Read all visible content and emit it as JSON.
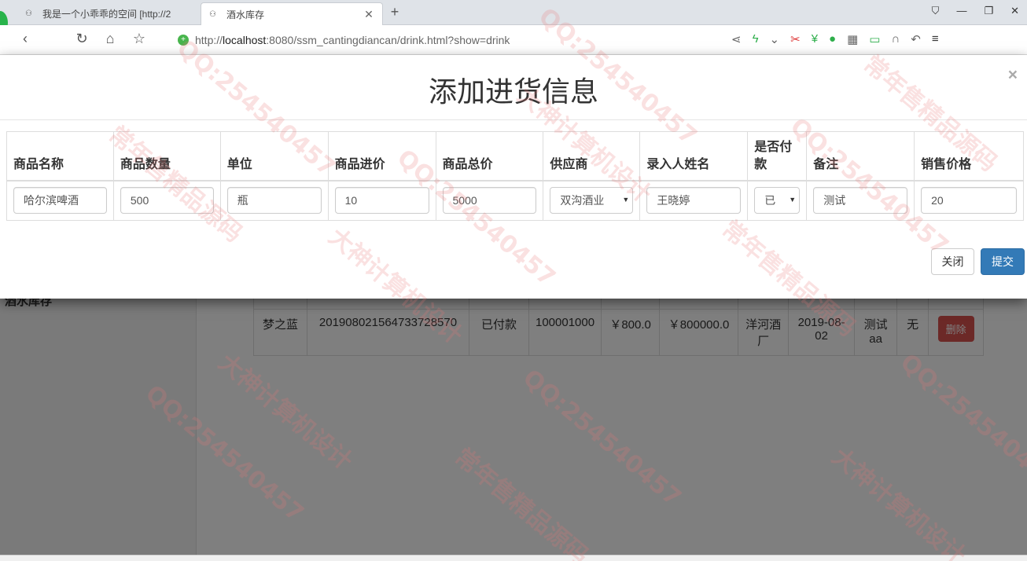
{
  "browser": {
    "tabs": [
      {
        "title": "我是一个小乖乖的空间 [http://2",
        "active": false
      },
      {
        "title": "酒水库存",
        "active": true
      }
    ],
    "url": {
      "prefix": "http://",
      "host": "localhost",
      "rest": ":8080/ssm_cantingdiancan/drink.html?show=drink"
    }
  },
  "sidebar": {
    "item_label": "酒水库存"
  },
  "background_table": {
    "row": [
      "梦之蓝",
      "20190802156473372857​0",
      "已付款",
      "100001000",
      "￥800.0",
      "￥800000.0",
      "洋河酒厂",
      "2019-08-02",
      "测试aa",
      "无"
    ],
    "delete_label": "删除"
  },
  "modal": {
    "title": "添加进货信息",
    "close_symbol": "×",
    "columns": [
      "商品名称",
      "商品数量",
      "单位",
      "商品进价",
      "商品总价",
      "供应商",
      "录入人姓名",
      "是否付款",
      "备注",
      "销售价格"
    ],
    "values": {
      "name": "哈尔滨啤酒",
      "quantity": "500",
      "unit": "瓶",
      "cost": "10",
      "total": "5000",
      "supplier": "双沟酒业",
      "operator": "王晓婷",
      "paid": "已",
      "note": "测试",
      "sale_price": "20"
    },
    "close_button": "关闭",
    "submit_button": "提交"
  },
  "watermarks": [
    "QQ:254540457",
    "常年售精品源码",
    "大神计算机设计"
  ]
}
